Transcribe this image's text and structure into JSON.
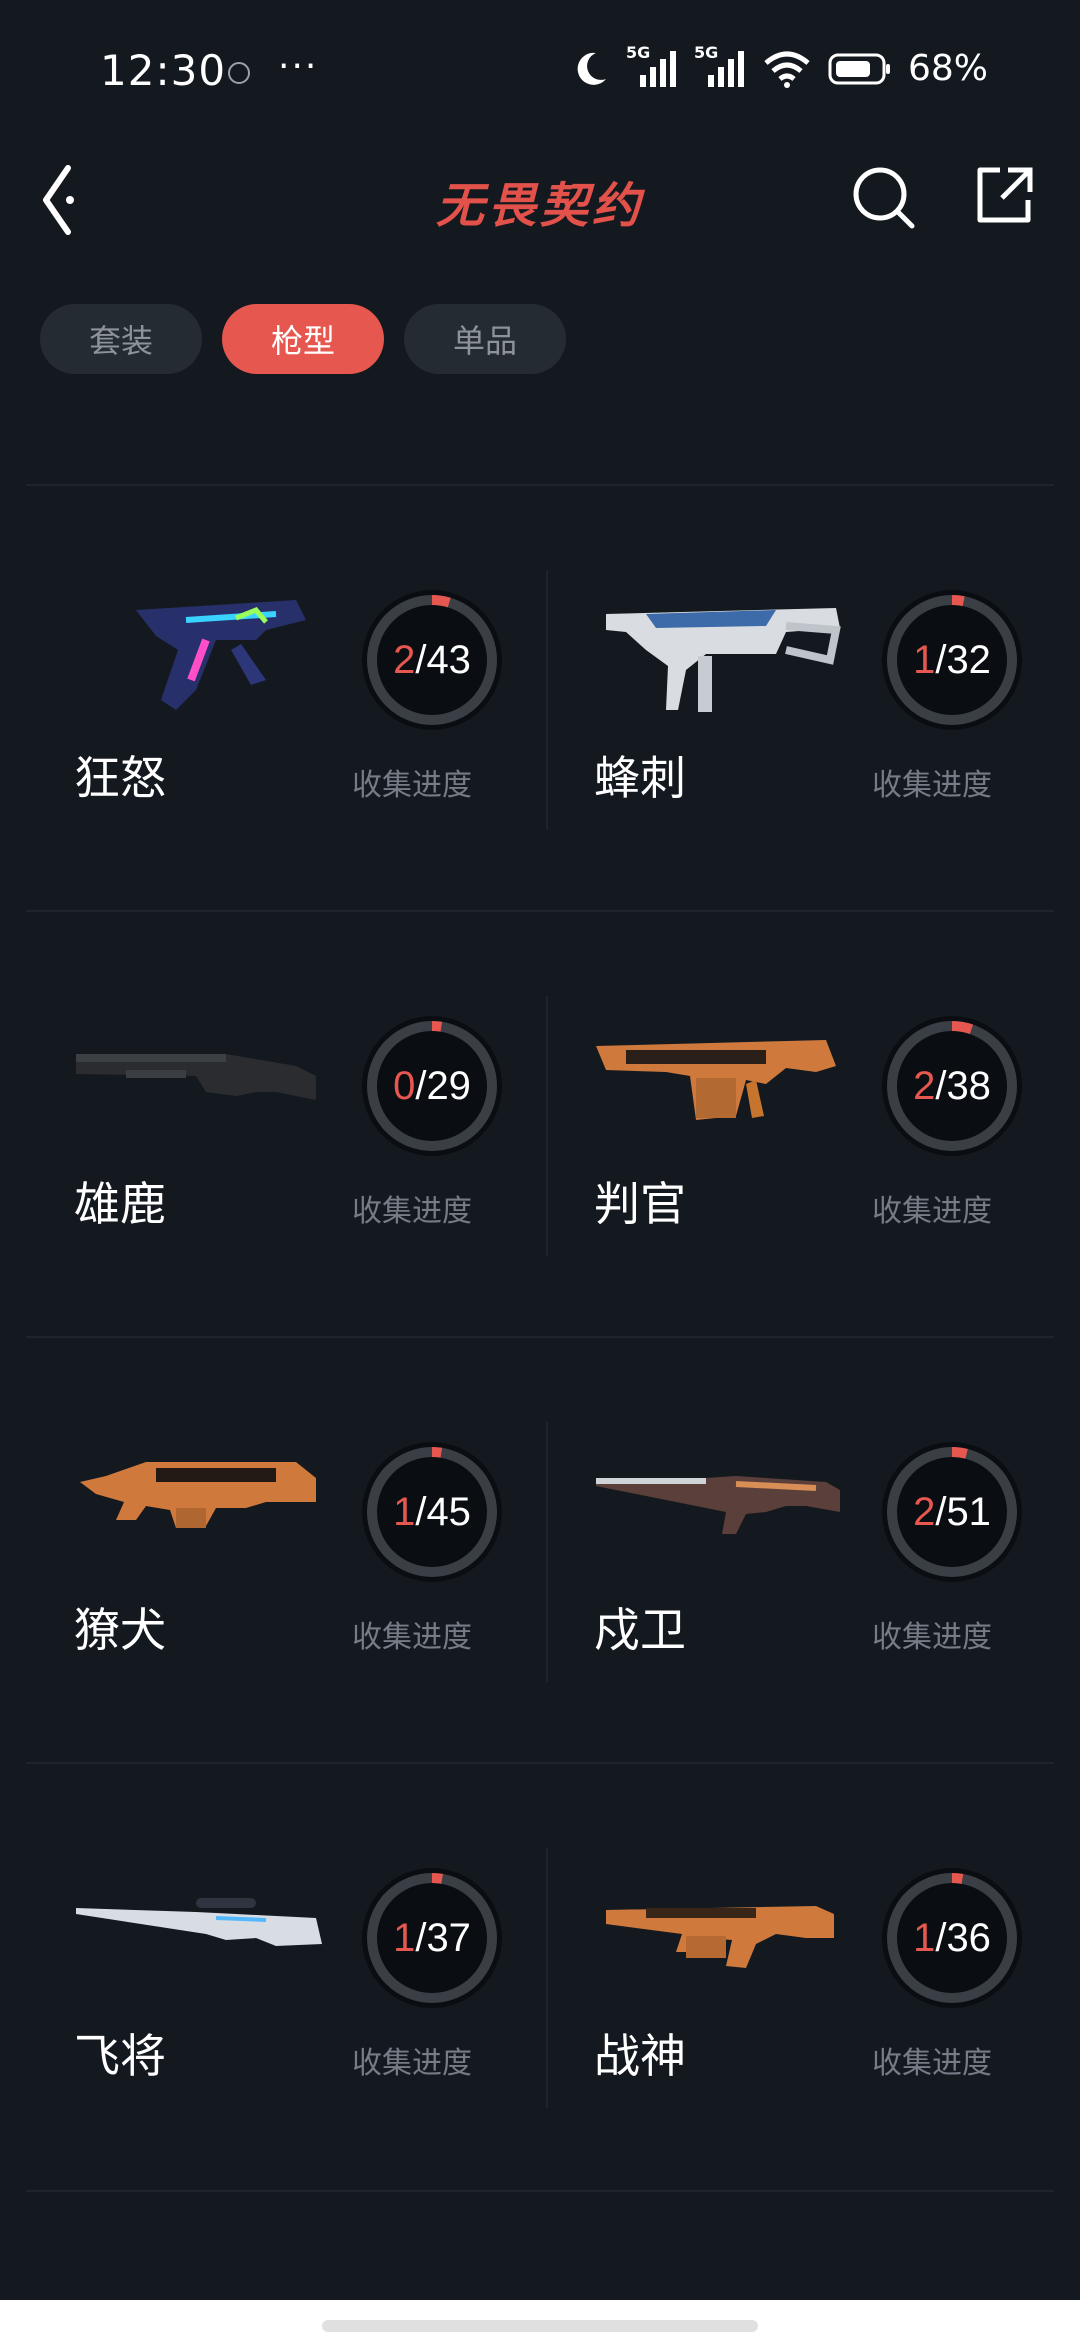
{
  "status_bar": {
    "time": "12:30",
    "more": "···",
    "network_1": "5G",
    "network_2": "5G",
    "battery": "68%"
  },
  "header": {
    "title": "无畏契约",
    "back_icon": "back-icon",
    "search_icon": "search-icon",
    "share_icon": "share-icon"
  },
  "tabs": [
    {
      "label": "套装",
      "active": false
    },
    {
      "label": "枪型",
      "active": true
    },
    {
      "label": "单品",
      "active": false
    }
  ],
  "progress_label": "收集进度",
  "colors": {
    "accent": "#e5574f",
    "background": "#141920",
    "ring_track": "#3a3f46"
  },
  "guns": [
    {
      "name": "狂怒",
      "collected": "2",
      "separator": "/",
      "total": "43",
      "progress": 0.0465,
      "icon": "pistol-icon"
    },
    {
      "name": "蜂刺",
      "collected": "1",
      "separator": "/",
      "total": "32",
      "progress": 0.03125,
      "icon": "smg-icon"
    },
    {
      "name": "雄鹿",
      "collected": "0",
      "separator": "/",
      "total": "29",
      "progress": 0,
      "icon": "shotgun-icon"
    },
    {
      "name": "判官",
      "collected": "2",
      "separator": "/",
      "total": "38",
      "progress": 0.0526,
      "icon": "auto-shotgun-icon"
    },
    {
      "name": "獠犬",
      "collected": "1",
      "separator": "/",
      "total": "45",
      "progress": 0.0222,
      "icon": "bullpup-rifle-icon"
    },
    {
      "name": "戍卫",
      "collected": "2",
      "separator": "/",
      "total": "51",
      "progress": 0.0392,
      "icon": "rifle-icon"
    },
    {
      "name": "飞将",
      "collected": "1",
      "separator": "/",
      "total": "37",
      "progress": 0.027,
      "icon": "sniper-icon"
    },
    {
      "name": "战神",
      "collected": "1",
      "separator": "/",
      "total": "36",
      "progress": 0.0278,
      "icon": "machine-gun-icon"
    }
  ]
}
